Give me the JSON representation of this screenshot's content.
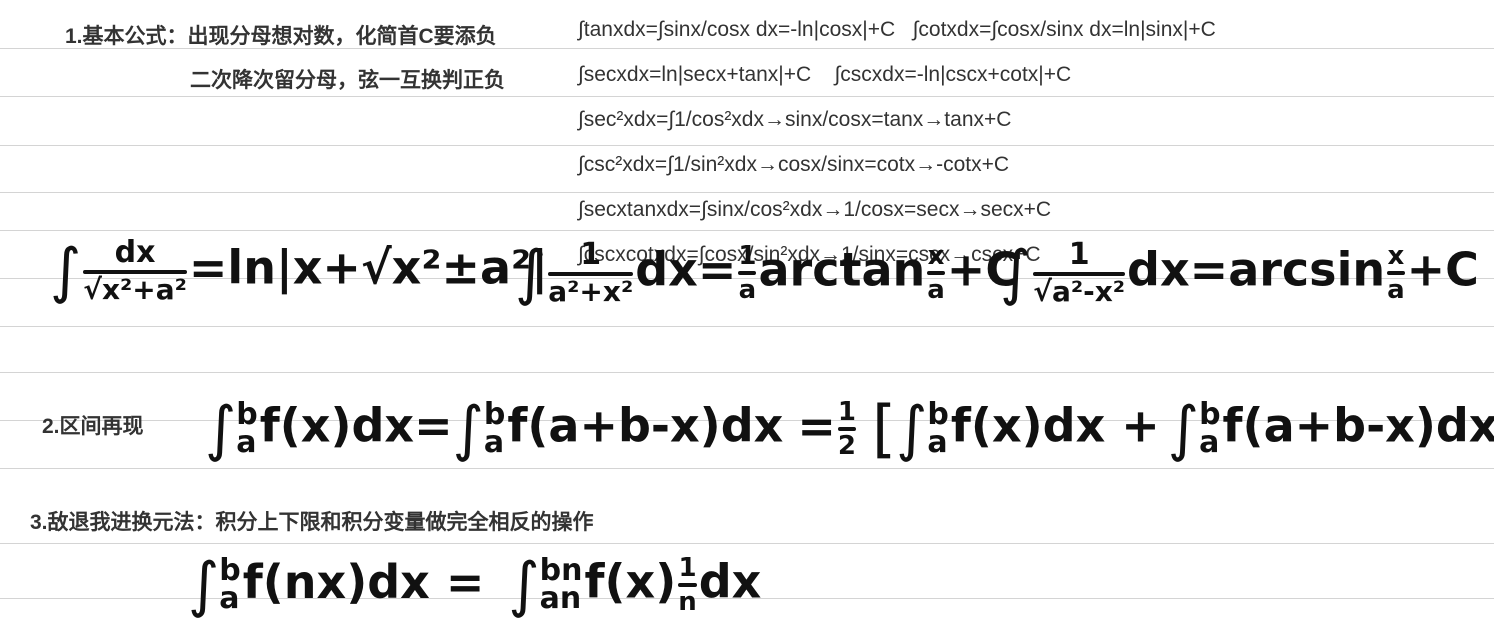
{
  "section1": {
    "heading_line1": "1.基本公式：出现分母想对数，化简首C要添负",
    "heading_line2": "二次降次留分母，弦一互换判正负",
    "formulas": [
      "∫tanxdx=∫sinx/cosx dx=-ln|cosx|+C   ∫cotxdx=∫cosx/sinx dx=ln|sinx|+C",
      "∫secxdx=ln|secx+tanx|+C    ∫cscxdx=-ln|cscx+cotx|+C",
      "∫sec²xdx=∫1/cos²xdx→sinx/cosx=tanx→tanx+C",
      "∫csc²xdx=∫1/sin²xdx→cosx/sinx=cotx→-cotx+C",
      "∫secxtanxdx=∫sinx/cos²xdx→1/cosx=secx→secx+C",
      "∫cscxcotxdx=∫cosx/sin²xdx→1/sinx=cscx→cscx+C"
    ]
  },
  "handwritten1": {
    "f1": {
      "integral": "∫",
      "num": "dx",
      "den": "√x²+a²",
      "rhs": "=ln|x+√x²±a²|"
    },
    "f2": {
      "integral": "∫",
      "num": "1",
      "den": "a²+x²",
      "mid": "dx=",
      "coef_num": "1",
      "coef_den": "a",
      "rhs1": "arctan",
      "arg_num": "x",
      "arg_den": "a",
      "rhs2": "+C"
    },
    "f3": {
      "integral": "∫",
      "num": "1",
      "den": "√a²-x²",
      "mid": "dx=arcsin",
      "arg_num": "x",
      "arg_den": "a",
      "rhs": "+C"
    }
  },
  "section2": {
    "heading": "2.区间再现",
    "lower": "a",
    "upper": "b",
    "part1": "f(x)dx=",
    "part2": "f(a+b-x)dx",
    "eq": "=",
    "half_num": "1",
    "half_den": "2",
    "open_bracket": "[",
    "part3": "f(x)dx +",
    "part4": "f(a+b-x)dx",
    "close_bracket": "]"
  },
  "section3": {
    "heading": "3.敌退我进换元法：积分上下限和积分变量做完全相反的操作",
    "lower1": "a",
    "upper1": "b",
    "part1": "f(nx)dx =",
    "lower2": "an",
    "upper2": "bn",
    "part2": "f(x)",
    "coef_num": "1",
    "coef_den": "n",
    "part3": "dx"
  }
}
